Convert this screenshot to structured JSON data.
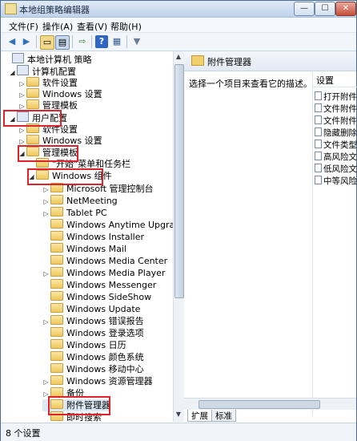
{
  "window": {
    "title": "本地组策略编辑器",
    "controls": {
      "minimize": "—",
      "maximize": "☐",
      "close": "✕"
    }
  },
  "menu": [
    "文件(F)",
    "操作(A)",
    "查看(V)",
    "帮助(H)"
  ],
  "toolbar": [
    {
      "name": "back-icon",
      "glyph": "◀"
    },
    {
      "name": "forward-icon",
      "glyph": "▶"
    },
    {
      "name": "up-folder-icon",
      "glyph": "▭"
    },
    {
      "name": "show-hide-tree-icon",
      "glyph": "▤"
    },
    {
      "name": "export-list-icon",
      "glyph": "⇨"
    },
    {
      "name": "help-icon",
      "glyph": "?"
    },
    {
      "name": "properties-icon",
      "glyph": "▦"
    },
    {
      "name": "filter-icon",
      "glyph": "▼"
    }
  ],
  "tree": [
    {
      "label": "本地计算机 策略",
      "icon": "policy",
      "exp": ""
    },
    {
      "label": "计算机配置",
      "icon": "computer",
      "exp": "◢"
    },
    {
      "label": "软件设置",
      "icon": "folder",
      "exp": "▷"
    },
    {
      "label": "Windows 设置",
      "icon": "folder",
      "exp": "▷"
    },
    {
      "label": "管理模板",
      "icon": "folder",
      "exp": "▷"
    },
    {
      "label": "用户配置",
      "icon": "user",
      "exp": "◢"
    },
    {
      "label": "软件设置",
      "icon": "folder",
      "exp": "▷"
    },
    {
      "label": "Windows 设置",
      "icon": "folder",
      "exp": "▷"
    },
    {
      "label": "管理模板",
      "icon": "folder",
      "exp": "◢"
    },
    {
      "label": "\"开始\"菜单和任务栏",
      "icon": "folder",
      "exp": ""
    },
    {
      "label": "Windows 组件",
      "icon": "folder",
      "exp": "◢"
    },
    {
      "label": "Microsoft 管理控制台",
      "icon": "folder",
      "exp": "▷"
    },
    {
      "label": "NetMeeting",
      "icon": "folder",
      "exp": "▷"
    },
    {
      "label": "Tablet PC",
      "icon": "folder",
      "exp": "▷"
    },
    {
      "label": "Windows Anytime Upgrade",
      "icon": "folder",
      "exp": ""
    },
    {
      "label": "Windows Installer",
      "icon": "folder",
      "exp": ""
    },
    {
      "label": "Windows Mail",
      "icon": "folder",
      "exp": ""
    },
    {
      "label": "Windows Media Center",
      "icon": "folder",
      "exp": ""
    },
    {
      "label": "Windows Media Player",
      "icon": "folder",
      "exp": "▷"
    },
    {
      "label": "Windows Messenger",
      "icon": "folder",
      "exp": ""
    },
    {
      "label": "Windows SideShow",
      "icon": "folder",
      "exp": ""
    },
    {
      "label": "Windows Update",
      "icon": "folder",
      "exp": ""
    },
    {
      "label": "Windows 错误报告",
      "icon": "folder",
      "exp": "▷"
    },
    {
      "label": "Windows 登录选项",
      "icon": "folder",
      "exp": ""
    },
    {
      "label": "Windows 日历",
      "icon": "folder",
      "exp": ""
    },
    {
      "label": "Windows 颜色系统",
      "icon": "folder",
      "exp": ""
    },
    {
      "label": "Windows 移动中心",
      "icon": "folder",
      "exp": ""
    },
    {
      "label": "Windows 资源管理器",
      "icon": "folder",
      "exp": "▷"
    },
    {
      "label": "备份",
      "icon": "folder",
      "exp": "▷"
    },
    {
      "label": "附件管理器",
      "icon": "folder",
      "exp": ""
    },
    {
      "label": "即时搜索",
      "icon": "folder",
      "exp": ""
    }
  ],
  "right": {
    "header_title": "附件管理器",
    "description": "选择一个项目来查看它的描述。",
    "settings_header": "设置",
    "settings": [
      "打开附件",
      "文件附件",
      "文件附件",
      "隐藏删除",
      "文件类型",
      "高风险文",
      "低风险文",
      "中等风险"
    ],
    "tabs": [
      "扩展",
      "标准"
    ]
  },
  "status": "8 个设置"
}
